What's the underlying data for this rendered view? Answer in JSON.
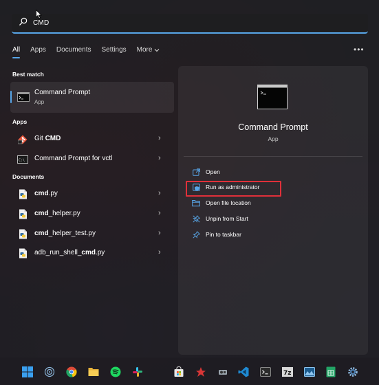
{
  "search": {
    "query": "CMD"
  },
  "tabs": [
    {
      "label": "All",
      "active": true
    },
    {
      "label": "Apps"
    },
    {
      "label": "Documents"
    },
    {
      "label": "Settings"
    },
    {
      "label": "More"
    }
  ],
  "more_menu_icon": "ellipsis-icon",
  "best_match": {
    "section_label": "Best match",
    "title": "Command Prompt",
    "subtitle": "App"
  },
  "apps": {
    "section_label": "Apps",
    "items": [
      {
        "prefix": "Git ",
        "bold": "CMD",
        "suffix": "",
        "icon": "git-cmd-icon"
      },
      {
        "prefix": "Command Prompt for vctl",
        "bold": "",
        "suffix": "",
        "icon": "terminal-icon"
      }
    ]
  },
  "documents": {
    "section_label": "Documents",
    "items": [
      {
        "prefix": "",
        "bold": "cmd",
        "suffix": ".py",
        "icon": "python-file-icon"
      },
      {
        "prefix": "",
        "bold": "cmd",
        "suffix": "_helper.py",
        "icon": "python-file-icon"
      },
      {
        "prefix": "",
        "bold": "cmd",
        "suffix": "_helper_test.py",
        "icon": "python-file-icon"
      },
      {
        "prefix": "adb_run_shell_",
        "bold": "cmd",
        "suffix": ".py",
        "icon": "python-file-icon"
      }
    ]
  },
  "panel": {
    "title": "Command Prompt",
    "subtitle": "App",
    "actions": [
      {
        "label": "Open",
        "icon": "open-icon"
      },
      {
        "label": "Run as administrator",
        "icon": "shield-icon",
        "highlighted": true
      },
      {
        "label": "Open file location",
        "icon": "folder-icon"
      },
      {
        "label": "Unpin from Start",
        "icon": "unpin-icon"
      },
      {
        "label": "Pin to taskbar",
        "icon": "pin-icon"
      }
    ]
  },
  "taskbar": {
    "icons": [
      "windows-start-icon",
      "wifi-icon",
      "chrome-icon",
      "file-explorer-icon",
      "spotify-icon",
      "slack-icon",
      "store-icon",
      "ghost-app-icon",
      "media-icon",
      "vscode-icon",
      "terminal-icon",
      "7zip-icon",
      "photos-icon",
      "sheets-icon",
      "settings-icon"
    ]
  },
  "colors": {
    "accent": "#58a6e8",
    "highlight_box": "#e0303a"
  }
}
